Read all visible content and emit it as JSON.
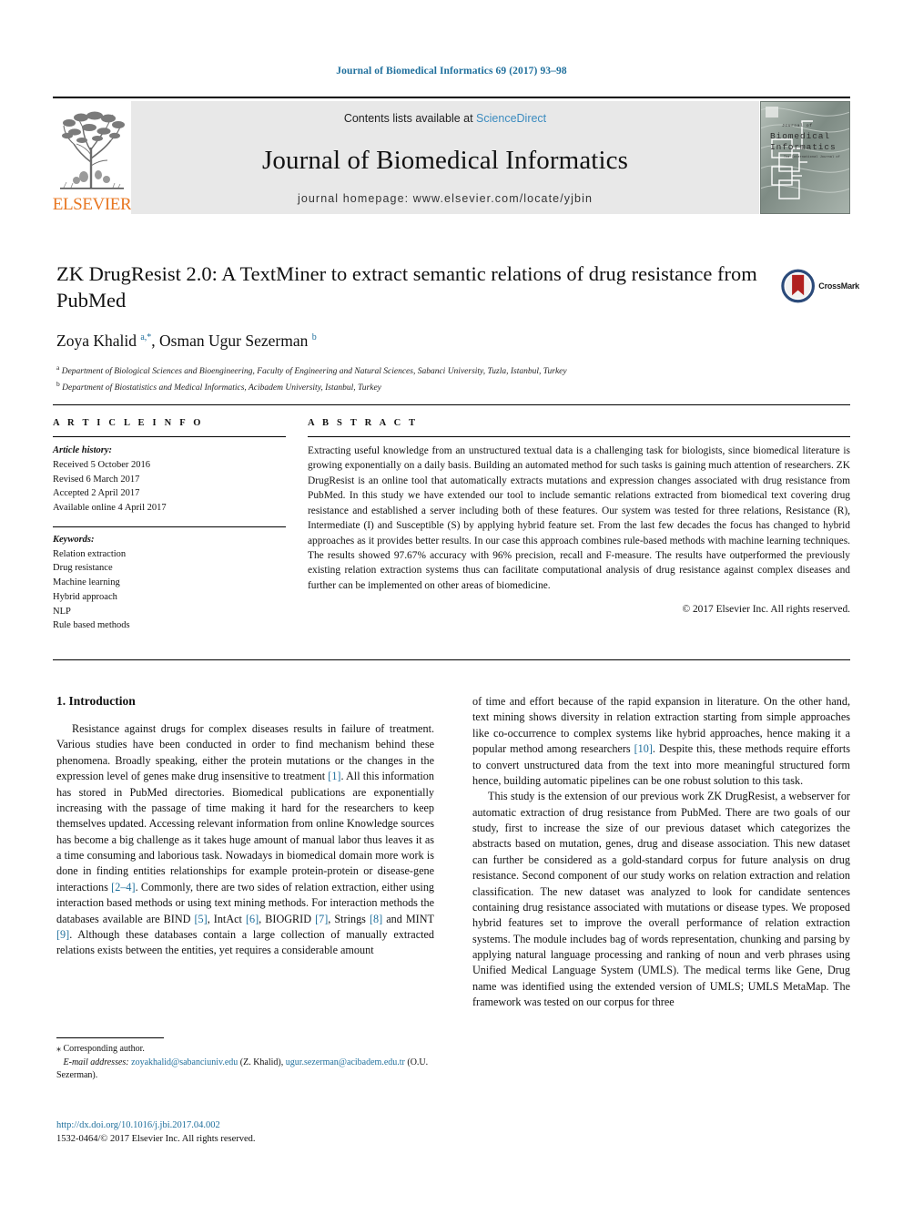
{
  "running_head": "Journal of Biomedical Informatics 69 (2017) 93–98",
  "masthead": {
    "contents_prefix": "Contents lists available at ",
    "sciencedirect": "ScienceDirect",
    "journal_name": "Journal of Biomedical Informatics",
    "homepage": "journal homepage: www.elsevier.com/locate/yjbin",
    "publisher_wordmark": "ELSEVIER",
    "cover_title_line1": "Journal of",
    "cover_title_line2": "Biomedical",
    "cover_title_line3": "Informatics",
    "accent_blue": "#3b8bbf",
    "elsevier_orange": "#E87722"
  },
  "article": {
    "title": "ZK DrugResist 2.0: A TextMiner to extract semantic relations of drug resistance from PubMed",
    "authors_html": "Zoya Khalid <sup>a,</sup><sup>*</sup>, Osman Ugur Sezerman <sup>b</sup>",
    "affiliation_a": "Department of Biological Sciences and Bioengineering, Faculty of Engineering and Natural Sciences, Sabanci University, Tuzla, Istanbul, Turkey",
    "affiliation_b": "Department of Biostatistics and Medical Informatics, Acibadem University, Istanbul, Turkey",
    "crossmark_label": "CrossMark"
  },
  "article_info": {
    "heading": "A R T I C L E  I N F O",
    "history_label": "Article history:",
    "history": [
      "Received 5 October 2016",
      "Revised 6 March 2017",
      "Accepted 2 April 2017",
      "Available online 4 April 2017"
    ],
    "keywords_label": "Keywords:",
    "keywords": [
      "Relation extraction",
      "Drug resistance",
      "Machine learning",
      "Hybrid approach",
      "NLP",
      "Rule based methods"
    ]
  },
  "abstract": {
    "heading": "A B S T R A C T",
    "text": "Extracting useful knowledge from an unstructured textual data is a challenging task for biologists, since biomedical literature is growing exponentially on a daily basis. Building an automated method for such tasks is gaining much attention of researchers. ZK DrugResist is an online tool that automatically extracts mutations and expression changes associated with drug resistance from PubMed. In this study we have extended our tool to include semantic relations extracted from biomedical text covering drug resistance and established a server including both of these features. Our system was tested for three relations, Resistance (R), Intermediate (I) and Susceptible (S) by applying hybrid feature set. From the last few decades the focus has changed to hybrid approaches as it provides better results. In our case this approach combines rule-based methods with machine learning techniques. The results showed 97.67% accuracy with 96% precision, recall and F-measure. The results have outperformed the previously existing relation extraction systems thus can facilitate computational analysis of drug resistance against complex diseases and further can be implemented on other areas of biomedicine.",
    "copyright": "© 2017 Elsevier Inc. All rights reserved."
  },
  "introduction": {
    "section_title": "1. Introduction",
    "left_para_1_pre": "Resistance against drugs for complex diseases results in failure of treatment. Various studies have been conducted in order to find mechanism behind these phenomena. Broadly speaking, either the protein mutations or the changes in the expression level of genes make drug insensitive to treatment ",
    "ref_1": "[1]",
    "left_para_1_mid": ". All this information has stored in PubMed directories. Biomedical publications are exponentially increasing with the passage of time making it hard for the researchers to keep themselves updated. Accessing relevant information from online Knowledge sources has become a big challenge as it takes huge amount of manual labor thus leaves it as a time consuming and laborious task. Nowadays in biomedical domain more work is done in finding entities relationships for example protein-protein or disease-gene interactions ",
    "ref_2_4": "[2–4]",
    "left_para_1_mid2": ". Commonly, there are two sides of relation extraction, either using interaction based methods or using text mining methods. For interaction methods the databases available are BIND ",
    "ref_5": "[5]",
    "left_para_1_mid3": ", IntAct ",
    "ref_6": "[6]",
    "left_para_1_mid4": ", BIOGRID ",
    "ref_7": "[7]",
    "left_para_1_mid5": ", Strings ",
    "ref_8": "[8]",
    "left_para_1_mid6": " and MINT ",
    "ref_9": "[9]",
    "left_para_1_end": ". Although these databases contain a large collection of manually extracted relations exists between the entities, yet requires a considerable amount",
    "right_para_1_pre": "of time and effort because of the rapid expansion in literature. On the other hand, text mining shows diversity in relation extraction starting from simple approaches like co-occurrence to complex systems like hybrid approaches, hence making it a popular method among researchers ",
    "ref_10": "[10]",
    "right_para_1_end": ". Despite this, these methods require efforts to convert unstructured data from the text into more meaningful structured form hence, building automatic pipelines can be one robust solution to this task.",
    "right_para_2": "This study is the extension of our previous work ZK DrugResist, a webserver for automatic extraction of drug resistance from PubMed. There are two goals of our study, first to increase the size of our previous dataset which categorizes the abstracts based on mutation, genes, drug and disease association. This new dataset can further be considered as a gold-standard corpus for future analysis on drug resistance. Second component of our study works on relation extraction and relation classification. The new dataset was analyzed to look for candidate sentences containing drug resistance associated with mutations or disease types. We proposed hybrid features set to improve the overall performance of relation extraction systems. The module includes bag of words representation, chunking and parsing by applying natural language processing and ranking of noun and verb phrases using Unified Medical Language System (UMLS). The medical terms like Gene, Drug name was identified using the extended version of UMLS; UMLS MetaMap. The framework was tested on our corpus for three"
  },
  "footnotes": {
    "corresponding": "⁎ Corresponding author.",
    "email_label": "E-mail addresses:",
    "email_1": "zoyakhalid@sabanciuniv.edu",
    "email_1_paren": "(Z. Khalid),",
    "email_2": "ugur.sezerman@acibadem.edu.tr",
    "email_2_paren": "(O.U. Sezerman).",
    "doi": "http://dx.doi.org/10.1016/j.jbi.2017.04.002",
    "issn": "1532-0464/© 2017 Elsevier Inc. All rights reserved."
  }
}
